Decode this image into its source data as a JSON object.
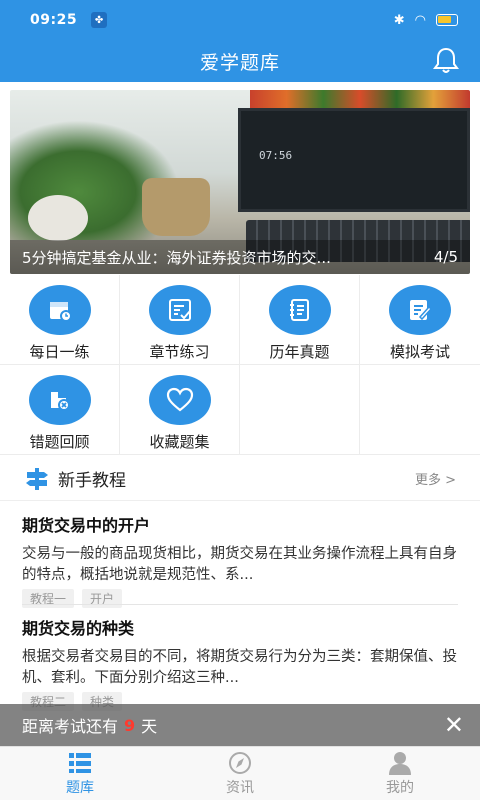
{
  "status": {
    "time": "09:25"
  },
  "appbar": {
    "title": "爱学题库"
  },
  "banner": {
    "caption": "5分钟搞定基金从业：海外证券投资市场的交...",
    "index": "4/5",
    "clock": "07:56"
  },
  "grid": {
    "items": [
      {
        "label": "每日一练",
        "icon": "calendar-icon"
      },
      {
        "label": "章节练习",
        "icon": "checklist-icon"
      },
      {
        "label": "历年真题",
        "icon": "notebook-icon"
      },
      {
        "label": "模拟考试",
        "icon": "edit-paper-icon"
      },
      {
        "label": "错题回顾",
        "icon": "error-folder-icon"
      },
      {
        "label": "收藏题集",
        "icon": "heart-icon"
      }
    ]
  },
  "tutorial": {
    "title": "新手教程",
    "more": "更多 >"
  },
  "articles": [
    {
      "title": "期货交易中的开户",
      "body": "交易与一般的商品现货相比，期货交易在其业务操作流程上具有自身的特点，概括地说就是规范性、系...",
      "tags": [
        "教程一",
        "开户"
      ]
    },
    {
      "title": "期货交易的种类",
      "body": "根据交易者交易目的不同，将期货交易行为分为三类：套期保值、投机、套利。下面分别介绍这三种...",
      "tags": [
        "教程二",
        "种类"
      ]
    }
  ],
  "toast": {
    "prefix": "距离考试还有",
    "days": "9",
    "unit": "天",
    "close": "✕"
  },
  "tabs": [
    {
      "label": "题库",
      "icon": "list-icon"
    },
    {
      "label": "资讯",
      "icon": "compass-icon"
    },
    {
      "label": "我的",
      "icon": "person-icon"
    }
  ],
  "colors": {
    "primary": "#2f93e4",
    "accent": "#ff3a2e"
  }
}
